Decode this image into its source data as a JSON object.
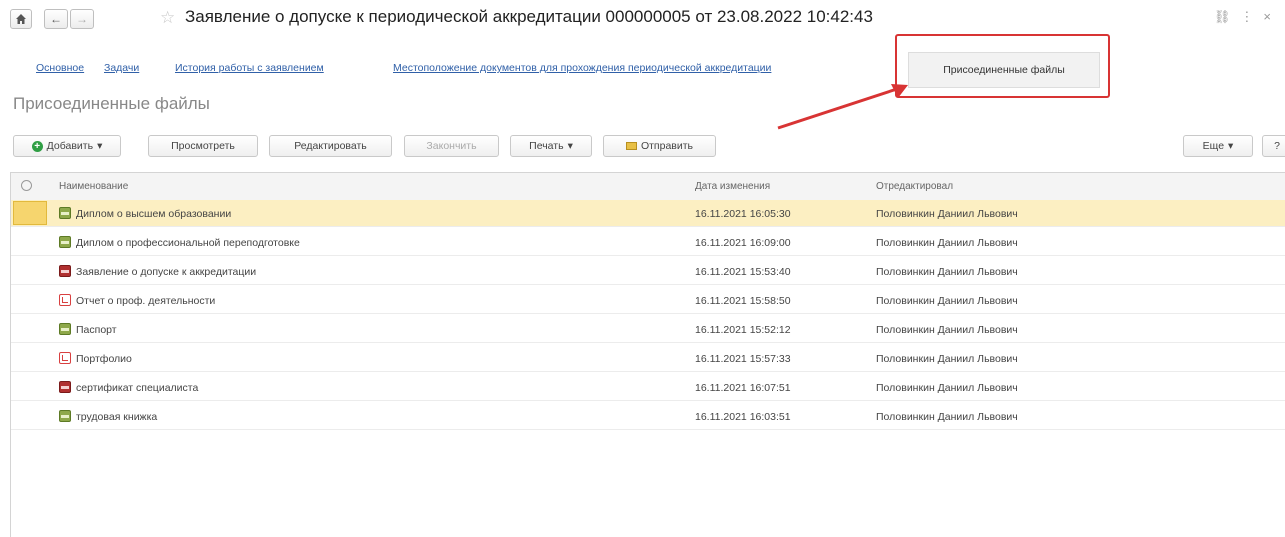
{
  "nav": {
    "home_icon": "home-icon",
    "back_icon": "arrow-left-icon",
    "forward_icon": "arrow-right-icon",
    "star_icon": "star-icon"
  },
  "title": "Заявление о допуске к периодической аккредитации 000000005 от 23.08.2022 10:42:43",
  "top_right_icons": [
    "link-icon",
    "more-icon",
    "close-icon"
  ],
  "tabs": [
    {
      "label": "Основное"
    },
    {
      "label": "Задачи"
    },
    {
      "label": "История работы с заявлением"
    },
    {
      "label": "Местоположение документов для прохождения периодической аккредитации"
    }
  ],
  "active_tab": "Присоединенные файлы",
  "annotation_color": "#d83434",
  "subtitle": "Присоединенные файлы",
  "toolbar": {
    "add": "Добавить",
    "view": "Просмотреть",
    "edit": "Редактировать",
    "finish": "Закончить",
    "print": "Печать",
    "send": "Отправить",
    "more": "Еще",
    "help": "?"
  },
  "table": {
    "columns": [
      "Наименование",
      "Дата изменения",
      "Отредактировал"
    ],
    "rows": [
      {
        "icon": "green",
        "name": "Диплом о высшем образовании",
        "date": "16.11.2021 16:05:30",
        "editor": "Половинкин Даниил Львович",
        "selected": true
      },
      {
        "icon": "green",
        "name": "Диплом о профессиональной переподготовке",
        "date": "16.11.2021 16:09:00",
        "editor": "Половинкин Даниил Львович"
      },
      {
        "icon": "red",
        "name": "Заявление о допуске к аккредитации",
        "date": "16.11.2021 15:53:40",
        "editor": "Половинкин Даниил Львович"
      },
      {
        "icon": "pdf",
        "name": "Отчет о проф. деятельности",
        "date": "16.11.2021 15:58:50",
        "editor": "Половинкин Даниил Львович"
      },
      {
        "icon": "green",
        "name": "Паспорт",
        "date": "16.11.2021 15:52:12",
        "editor": "Половинкин Даниил Львович"
      },
      {
        "icon": "pdf",
        "name": "Портфолио",
        "date": "16.11.2021 15:57:33",
        "editor": "Половинкин Даниил Львович"
      },
      {
        "icon": "red",
        "name": "сертификат специалиста",
        "date": "16.11.2021 16:07:51",
        "editor": "Половинкин Даниил Львович"
      },
      {
        "icon": "green",
        "name": "трудовая книжка",
        "date": "16.11.2021 16:03:51",
        "editor": "Половинкин Даниил Львович"
      }
    ]
  }
}
